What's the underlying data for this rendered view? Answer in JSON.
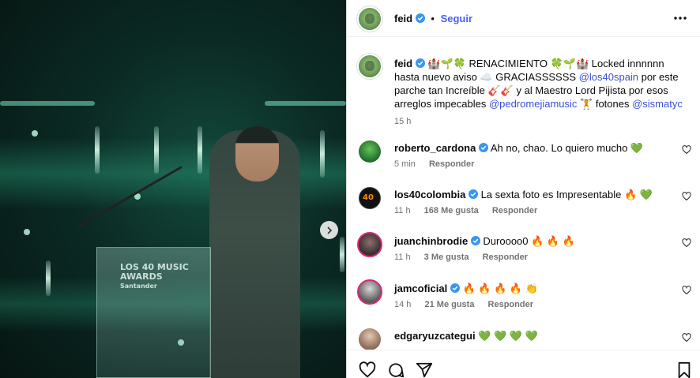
{
  "post": {
    "author": "feid",
    "follow_label": "Seguir",
    "dot": "•",
    "more_icon": "more-icon"
  },
  "caption": {
    "author": "feid",
    "text_part1": "🏰🌱🍀 RENACIMIENTO 🍀🌱🏰 Locked innnnnn hasta nuevo aviso ☁️ GRACIASSSSSS ",
    "mention1": "@los40spain",
    "text_part2": " por este parche tan Increíble 🎸🎸 y al Maestro Lord Pijista por esos arreglos impecables ",
    "mention2": "@pedromejiamusic",
    "text_part3": " 🏋️ fotones ",
    "mention3": "@sismatyc",
    "time": "15 h"
  },
  "comments": [
    {
      "user": "roberto_cardona",
      "text": "Ah no, chao. Lo quiero mucho 💚",
      "time": "5 min",
      "likes": "",
      "reply": "Responder",
      "avatar_color": "#1f6b2a"
    },
    {
      "user": "los40colombia",
      "text": "La sexta foto es Impresentable 🔥 💚",
      "time": "11 h",
      "likes": "168 Me gusta",
      "reply": "Responder",
      "avatar_color": "#111111"
    },
    {
      "user": "juanchinbrodie",
      "text": "Duroooo0 🔥 🔥 🔥",
      "time": "11 h",
      "likes": "3 Me gusta",
      "reply": "Responder",
      "avatar_color": "#4a3b3b"
    },
    {
      "user": "jamcoficial",
      "text": "🔥 🔥 🔥 🔥 👏",
      "time": "14 h",
      "likes": "21 Me gusta",
      "reply": "Responder",
      "avatar_color": "#3a3a3a"
    },
    {
      "user": "edgaryuzcategui",
      "text": "💚 💚 💚 💚",
      "time": "",
      "likes": "",
      "reply": "",
      "avatar_color": "#c9a48a"
    }
  ],
  "photo": {
    "logo_lines": [
      "LOS 40 MUSIC",
      "AWARDS",
      "Santander"
    ]
  },
  "colors": {
    "accent": "#4a5df9",
    "mention": "#3951d6",
    "verified": "#3897f0",
    "like": "#e0245e"
  }
}
